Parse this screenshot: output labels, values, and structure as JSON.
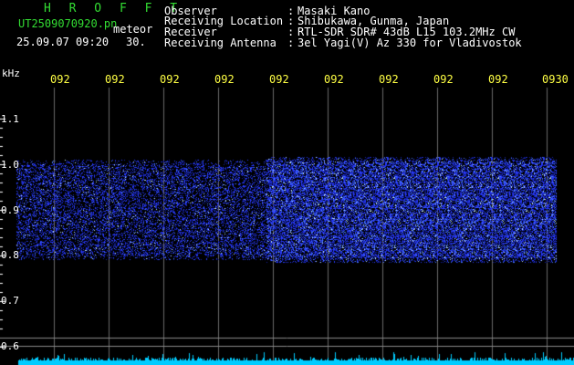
{
  "brand": "H R O F F T",
  "file_name": "UT2509070920.pn",
  "mode": "meteor",
  "datetime": "25.09.07 09:20",
  "interval": "30.",
  "info": [
    {
      "label": "Observer",
      "value": "Masaki Kano"
    },
    {
      "label": "Receiving Location",
      "value": "Shibukawa, Gunma, Japan"
    },
    {
      "label": "Receiver",
      "value": "RTL-SDR SDR# 43dB L15 103.2MHz CW"
    },
    {
      "label": "Receiving Antenna",
      "value": "3el Yagi(V) Az 330 for Vladivostok"
    }
  ],
  "freq_unit": "kHz",
  "time_ticks": [
    "092",
    "092",
    "092",
    "092",
    "092",
    "092",
    "092",
    "092",
    "092",
    "0930"
  ],
  "freq_ticks": [
    "1.1",
    "1.0",
    "0.9",
    "0.8",
    "0.7",
    "0.6"
  ],
  "colors": {
    "text_green": "#33dd33",
    "text_white": "#ffffff",
    "tick_yellow": "#ffff44",
    "grid": "#888888",
    "signal": "#2a3cff",
    "baseline": "#00ccff"
  }
}
